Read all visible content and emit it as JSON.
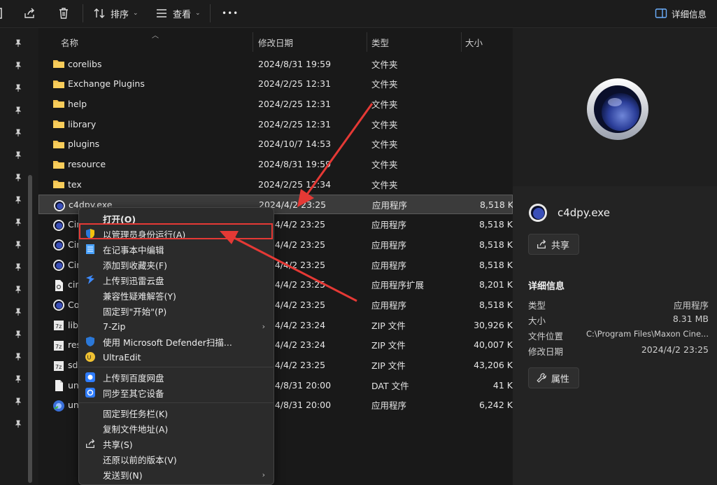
{
  "toolbar": {
    "sort_label": "排序",
    "view_label": "查看",
    "more_label": "•••",
    "details_label": "详细信息"
  },
  "columns": {
    "name": "名称",
    "date": "修改日期",
    "type": "类型",
    "size": "大小"
  },
  "files": [
    {
      "name": "corelibs",
      "date": "2024/8/31 19:59",
      "type": "文件夹",
      "size": "",
      "icon": "folder-icon"
    },
    {
      "name": "Exchange Plugins",
      "date": "2024/2/25 12:31",
      "type": "文件夹",
      "size": "",
      "icon": "folder-icon"
    },
    {
      "name": "help",
      "date": "2024/2/25 12:31",
      "type": "文件夹",
      "size": "",
      "icon": "folder-icon"
    },
    {
      "name": "library",
      "date": "2024/2/25 12:31",
      "type": "文件夹",
      "size": "",
      "icon": "folder-icon"
    },
    {
      "name": "plugins",
      "date": "2024/10/7 14:53",
      "type": "文件夹",
      "size": "",
      "icon": "folder-icon"
    },
    {
      "name": "resource",
      "date": "2024/8/31 19:59",
      "type": "文件夹",
      "size": "",
      "icon": "folder-icon"
    },
    {
      "name": "tex",
      "date": "2024/2/25 12:34",
      "type": "文件夹",
      "size": "",
      "icon": "folder-icon"
    },
    {
      "name": "c4dpy.exe",
      "date": "2024/4/2 23:25",
      "type": "应用程序",
      "size": "8,518 K",
      "icon": "cinema4d-icon"
    },
    {
      "name": "Cin",
      "date": "2024/4/2 23:25",
      "type": "应用程序",
      "size": "8,518 K",
      "icon": "cinema4d-icon"
    },
    {
      "name": "Cin",
      "date": "2024/4/2 23:25",
      "type": "应用程序",
      "size": "8,518 K",
      "icon": "cinema4d-icon"
    },
    {
      "name": "Cin",
      "date": "2024/4/2 23:25",
      "type": "应用程序",
      "size": "8,518 K",
      "icon": "cinema4d-icon"
    },
    {
      "name": "cin",
      "date": "2024/4/2 23:25",
      "type": "应用程序扩展",
      "size": "8,201 K",
      "icon": "dll-icon"
    },
    {
      "name": "Co",
      "date": "2024/4/2 23:25",
      "type": "应用程序",
      "size": "8,518 K",
      "icon": "cinema4d-icon"
    },
    {
      "name": "lib",
      "date": "2024/4/2 23:24",
      "type": "ZIP 文件",
      "size": "30,926 K",
      "icon": "zip-icon"
    },
    {
      "name": "res",
      "date": "2024/4/2 23:24",
      "type": "ZIP 文件",
      "size": "40,007 K",
      "icon": "zip-icon"
    },
    {
      "name": "sdl",
      "date": "2024/4/2 23:25",
      "type": "ZIP 文件",
      "size": "43,206 K",
      "icon": "zip-icon"
    },
    {
      "name": "un",
      "date": "2024/8/31 20:00",
      "type": "DAT 文件",
      "size": "41 K",
      "icon": "file-icon"
    },
    {
      "name": "un",
      "date": "2024/8/31 20:00",
      "type": "应用程序",
      "size": "6,242 K",
      "icon": "uninstall-icon"
    }
  ],
  "context_menu": {
    "items": [
      {
        "label": "打开(O)",
        "icon": "",
        "bold": true
      },
      {
        "label": "以管理员身份运行(A)",
        "icon": "uac-shield-icon"
      },
      {
        "label": "在记事本中编辑",
        "icon": "notepad-icon"
      },
      {
        "label": "添加到收藏夹(F)",
        "icon": ""
      },
      {
        "label": "上传到迅雷云盘",
        "icon": "thunder-icon"
      },
      {
        "label": "兼容性疑难解答(Y)",
        "icon": ""
      },
      {
        "label": "固定到\"开始\"(P)",
        "icon": ""
      },
      {
        "label": "7-Zip",
        "icon": "",
        "submenu": true
      },
      {
        "label": "使用 Microsoft Defender扫描...",
        "icon": "defender-icon"
      },
      {
        "label": "UltraEdit",
        "icon": "ultraedit-icon"
      },
      {
        "label": "上传到百度网盘",
        "icon": "baidu-icon"
      },
      {
        "label": "同步至其它设备",
        "icon": "baidu-sync-icon"
      },
      {
        "label": "固定到任务栏(K)",
        "icon": ""
      },
      {
        "label": "复制文件地址(A)",
        "icon": ""
      },
      {
        "label": "共享(S)",
        "icon": "share-icon"
      },
      {
        "label": "还原以前的版本(V)",
        "icon": ""
      },
      {
        "label": "发送到(N)",
        "icon": "",
        "submenu": true
      }
    ]
  },
  "details": {
    "file_name": "c4dpy.exe",
    "share_label": "共享",
    "section_title": "详细信息",
    "props": [
      {
        "label": "类型",
        "value": "应用程序"
      },
      {
        "label": "大小",
        "value": "8.31 MB"
      },
      {
        "label": "文件位置",
        "value": "C:\\Program Files\\Maxon Cine..."
      },
      {
        "label": "修改日期",
        "value": "2024/4/2 23:25"
      }
    ],
    "properties_label": "属性"
  },
  "colors": {
    "annotation_red": "#e53935",
    "folder_yellow": "#f2c14e"
  }
}
